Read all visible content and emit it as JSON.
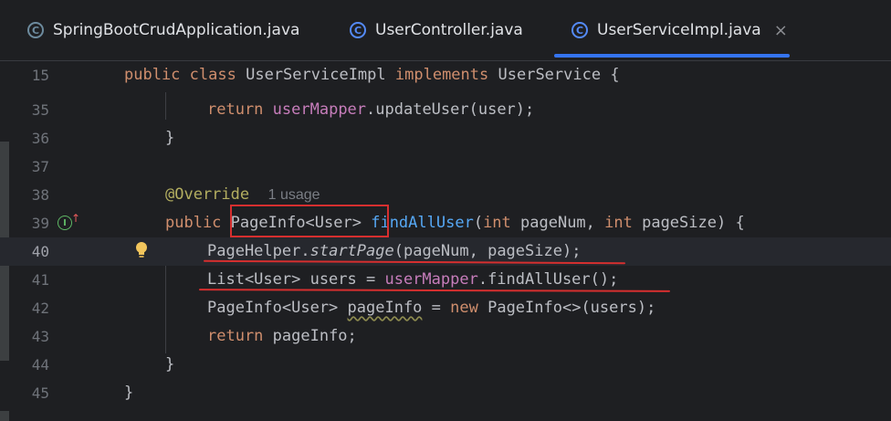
{
  "tabs": [
    {
      "label": "SpringBootCrudApplication.java",
      "icon": "spring-boot-class-icon",
      "active": false
    },
    {
      "label": "UserController.java",
      "icon": "class-icon",
      "active": false
    },
    {
      "label": "UserServiceImpl.java",
      "icon": "class-icon",
      "active": true
    }
  ],
  "colors": {
    "accent": "#3574f0",
    "annotation_red": "#d62f2f",
    "keyword": "#cf8e6d",
    "function": "#56a8f5",
    "field": "#c77dbb"
  },
  "editor": {
    "lines": {
      "l15": {
        "num": "15",
        "kw1": "public",
        "kw2": "class",
        "name": "UserServiceImpl",
        "kw3": "implements",
        "iface": "UserService",
        "brace": "{"
      },
      "l35": {
        "num": "35",
        "kw": "return",
        "field": "userMapper",
        "rest": ".updateUser(user);"
      },
      "l36": {
        "num": "36",
        "brace": "}"
      },
      "l37": {
        "num": "37"
      },
      "l38": {
        "num": "38",
        "ann": "@Override",
        "hint": "1 usage"
      },
      "l39": {
        "num": "39",
        "kw": "public",
        "type": "PageInfo<User>",
        "fn": "findAllUser",
        "p1": "(",
        "kwint1": "int",
        "p2": " pageNum, ",
        "kwint2": "int",
        "p3": " pageSize) {"
      },
      "l40": {
        "num": "40",
        "cls": "PageHelper",
        "dot": ".",
        "method": "startPage",
        "args": "(pageNum, pageSize);"
      },
      "l41": {
        "num": "41",
        "decl": "List<User> users = ",
        "field": "userMapper",
        "call": ".findAllUser();"
      },
      "l42": {
        "num": "42",
        "decl": "PageInfo<User> ",
        "var": "pageInfo",
        "eq": " = ",
        "kw": "new",
        "rest": " PageInfo<>(users);"
      },
      "l43": {
        "num": "43",
        "kw": "return",
        "rest": " pageInfo;"
      },
      "l44": {
        "num": "44",
        "brace": "}"
      },
      "l45": {
        "num": "45",
        "brace": "}"
      }
    }
  }
}
